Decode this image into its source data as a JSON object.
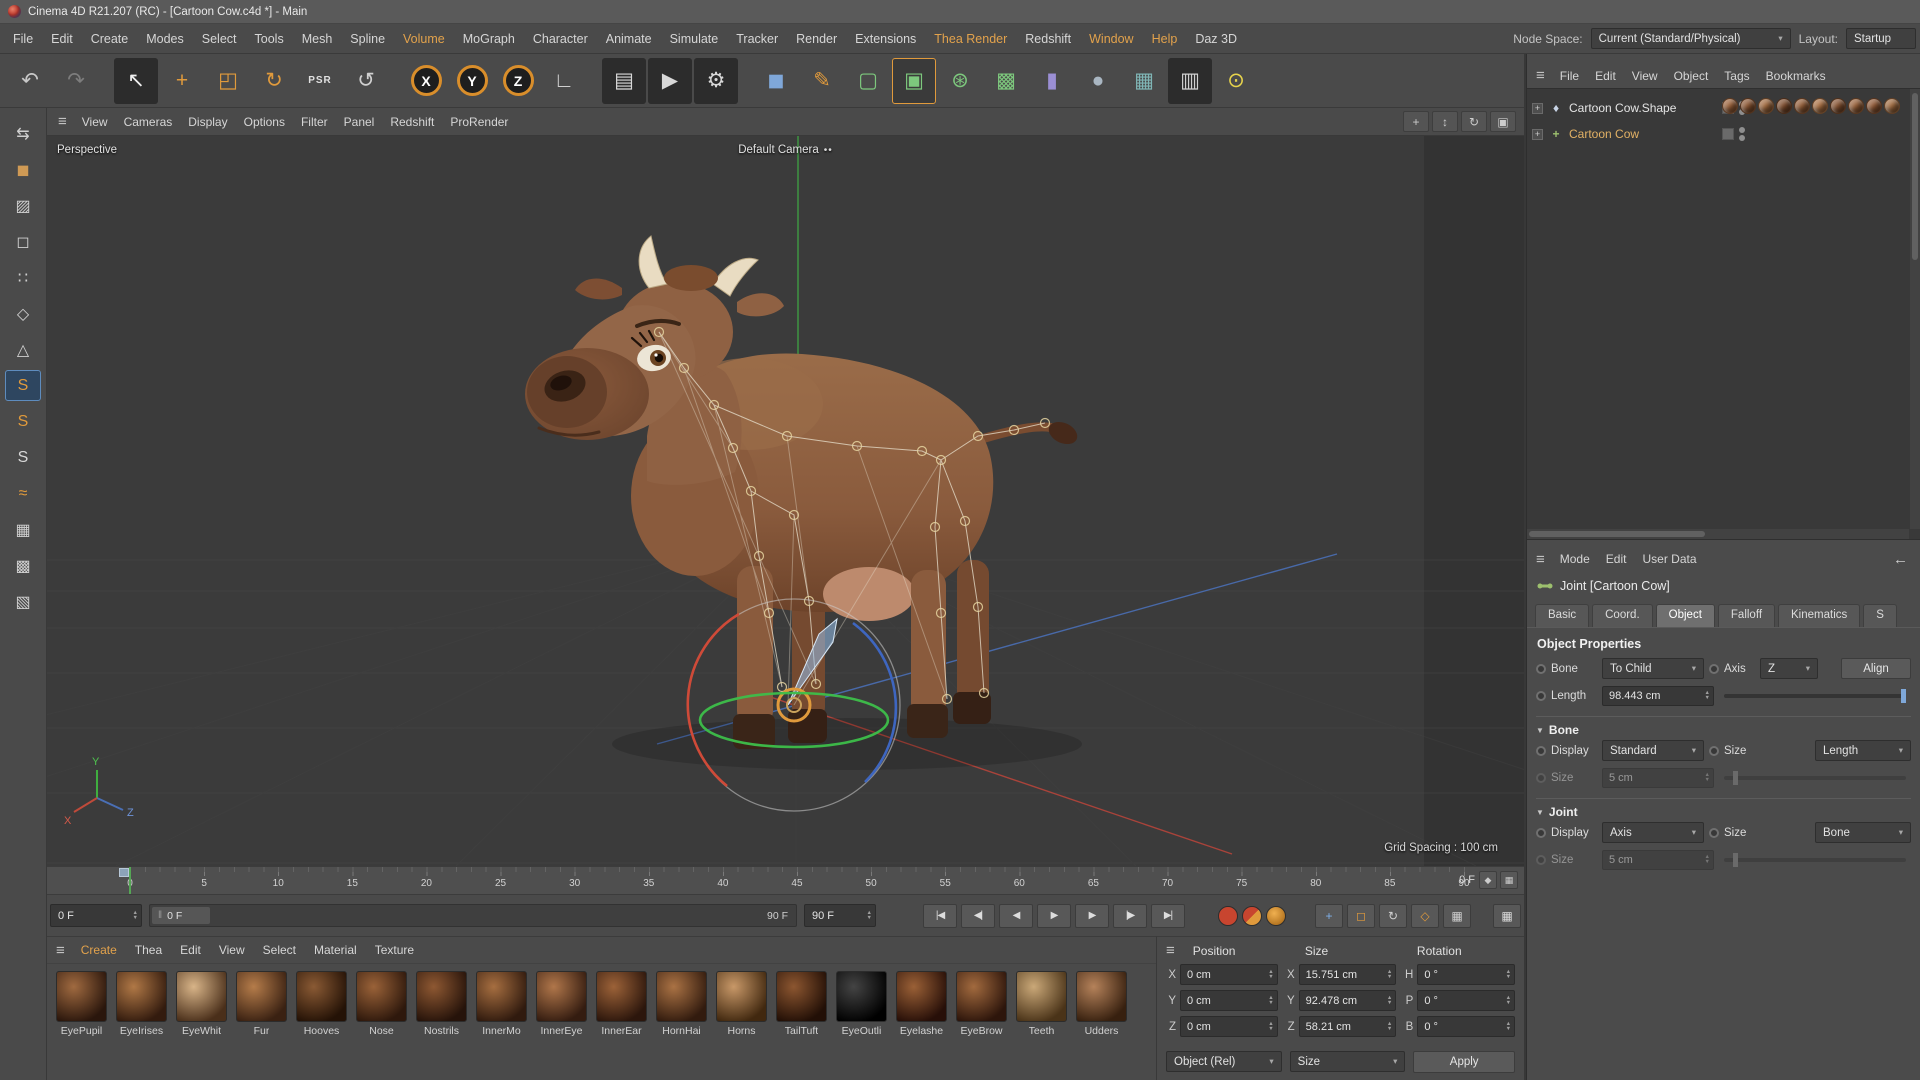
{
  "titlebar": {
    "title": "Cinema 4D R21.207 (RC) - [Cartoon Cow.c4d *] - Main"
  },
  "menubar": {
    "items": [
      {
        "label": "File"
      },
      {
        "label": "Edit"
      },
      {
        "label": "Create"
      },
      {
        "label": "Modes"
      },
      {
        "label": "Select"
      },
      {
        "label": "Tools"
      },
      {
        "label": "Mesh"
      },
      {
        "label": "Spline"
      },
      {
        "label": "Volume",
        "accent": true
      },
      {
        "label": "MoGraph"
      },
      {
        "label": "Character"
      },
      {
        "label": "Animate"
      },
      {
        "label": "Simulate"
      },
      {
        "label": "Tracker"
      },
      {
        "label": "Render"
      },
      {
        "label": "Extensions"
      },
      {
        "label": "Thea Render",
        "accent": true
      },
      {
        "label": "Redshift"
      },
      {
        "label": "Window",
        "accent": true
      },
      {
        "label": "Help",
        "accent": true
      },
      {
        "label": "Daz 3D"
      }
    ],
    "node_space_label": "Node Space:",
    "node_space_value": "Current (Standard/Physical)",
    "layout_label": "Layout:",
    "layout_value": "Startup"
  },
  "toolbar": {
    "buttons": [
      {
        "name": "undo-button",
        "glyph": "↶",
        "fg": "#c8c8c8"
      },
      {
        "name": "redo-button",
        "glyph": "↷",
        "fg": "#7d7d7d"
      },
      {
        "name": "toolbar-separator",
        "sep": true
      },
      {
        "name": "live-selection-tool",
        "glyph": "↖",
        "fg": "#f0f0f0",
        "bg": "#2c2c2c"
      },
      {
        "name": "move-tool",
        "glyph": "+",
        "fg": "#e09a3c"
      },
      {
        "name": "scale-tool",
        "glyph": "◰",
        "fg": "#e09a3c"
      },
      {
        "name": "rotate-tool",
        "glyph": "↻",
        "fg": "#e09a3c"
      },
      {
        "name": "psr-tool",
        "glyph": "PSR",
        "fg": "#e0e0e0",
        "small": true
      },
      {
        "name": "last-tool-used",
        "glyph": "↺",
        "fg": "#d0d0d0"
      },
      {
        "name": "toolbar-separator",
        "sep": true
      },
      {
        "name": "lock-x-axis",
        "glyph": "X",
        "ring": true
      },
      {
        "name": "lock-y-axis",
        "glyph": "Y",
        "ring": true
      },
      {
        "name": "lock-z-axis",
        "glyph": "Z",
        "ring": true
      },
      {
        "name": "coordinate-system",
        "glyph": "∟",
        "fg": "#d0d0d0"
      },
      {
        "name": "toolbar-separator",
        "sep": true
      },
      {
        "name": "render-view-button",
        "glyph": "▤",
        "fg": "#d8d8d8",
        "bg": "#2c2c2c"
      },
      {
        "name": "render-picture-viewer-button",
        "glyph": "▶",
        "fg": "#d8d8d8",
        "bg": "#2c2c2c"
      },
      {
        "name": "render-settings-button",
        "glyph": "⚙",
        "fg": "#d8d8d8",
        "bg": "#2c2c2c"
      },
      {
        "name": "toolbar-separator",
        "sep": true
      },
      {
        "name": "primitive-cube-menu",
        "glyph": "◼",
        "fg": "#7fa7d9"
      },
      {
        "name": "pen-spline-menu",
        "glyph": "✎",
        "fg": "#e09a3c"
      },
      {
        "name": "subdivision-surface-menu",
        "glyph": "▢",
        "fg": "#7dc87d"
      },
      {
        "name": "generators-menu",
        "glyph": "▣",
        "fg": "#7dc87d",
        "active": true
      },
      {
        "name": "modeling-menu",
        "glyph": "⊛",
        "fg": "#7dc87d"
      },
      {
        "name": "volume-menu",
        "glyph": "▩",
        "fg": "#7dc87d"
      },
      {
        "name": "spline-tools-menu",
        "glyph": "▮",
        "fg": "#9b8fd4"
      },
      {
        "name": "simulate-menu",
        "glyph": "●",
        "fg": "#a9b6c2"
      },
      {
        "name": "field-menu",
        "glyph": "▦",
        "fg": "#7fb5b5"
      },
      {
        "name": "camera-menu",
        "glyph": "▥",
        "fg": "#d0d0d0",
        "bg": "#2c2c2c"
      },
      {
        "name": "light-menu",
        "glyph": "⊙",
        "fg": "#e8d44c"
      }
    ]
  },
  "sidebar": {
    "buttons": [
      {
        "name": "make-editable-button",
        "glyph": "⇆",
        "fg": "#cfcfcf"
      },
      {
        "name": "model-mode-button",
        "glyph": "◼",
        "fg": "#cf9a55"
      },
      {
        "name": "texture-mode-button",
        "glyph": "▨",
        "fg": "#cfcfcf"
      },
      {
        "name": "workplane-mode-button",
        "glyph": "◻",
        "fg": "#cfcfcf"
      },
      {
        "name": "points-mode-button",
        "glyph": "∷",
        "fg": "#cfcfcf"
      },
      {
        "name": "edges-mode-button",
        "glyph": "◇",
        "fg": "#cfcfcf"
      },
      {
        "name": "polygons-mode-button",
        "glyph": "△",
        "fg": "#cfcfcf"
      },
      {
        "name": "enable-snap-button",
        "glyph": "S",
        "fg": "#e09a3c",
        "active": true
      },
      {
        "name": "snap-settings-button",
        "glyph": "S",
        "fg": "#e09a3c"
      },
      {
        "name": "snap-modes-button",
        "glyph": "S",
        "fg": "#d8d8d8"
      },
      {
        "name": "spline-snap-button",
        "glyph": "≈",
        "fg": "#e09a3c"
      },
      {
        "name": "quantize-button",
        "glyph": "▦",
        "fg": "#cfcfcf"
      },
      {
        "name": "workplane-lock-button",
        "glyph": "▩",
        "fg": "#cfcfcf"
      },
      {
        "name": "workplane-options-button",
        "glyph": "▧",
        "fg": "#cfcfcf"
      }
    ]
  },
  "viewport": {
    "menu": [
      {
        "label": "View"
      },
      {
        "label": "Cameras"
      },
      {
        "label": "Display"
      },
      {
        "label": "Options"
      },
      {
        "label": "Filter"
      },
      {
        "label": "Panel"
      },
      {
        "label": "Redshift"
      },
      {
        "label": "ProRender"
      }
    ],
    "nav": [
      {
        "name": "pan-view-button",
        "glyph": "+"
      },
      {
        "name": "zoom-view-button",
        "glyph": "↕"
      },
      {
        "name": "rotate-view-button",
        "glyph": "↻"
      },
      {
        "name": "maximize-view-button",
        "glyph": "▣"
      }
    ],
    "perspective_label": "Perspective",
    "camera_label": "Default Camera",
    "grid_spacing": "Grid Spacing : 100 cm",
    "axis_x": "X",
    "axis_y": "Y",
    "axis_z": "Z"
  },
  "timeline": {
    "ticks": [
      "0",
      "5",
      "10",
      "15",
      "20",
      "25",
      "30",
      "35",
      "40",
      "45",
      "50",
      "55",
      "60",
      "65",
      "70",
      "75",
      "80",
      "85",
      "90"
    ],
    "current_frame": "0 F",
    "ruler_buttons": [
      {
        "name": "ruler-marker-button",
        "glyph": "◆"
      },
      {
        "name": "ruler-options-button",
        "glyph": "▦"
      }
    ],
    "start_field": "0 F",
    "range_start": "0 F",
    "range_end": "90 F",
    "end_field": "90 F",
    "nav": [
      {
        "name": "goto-start-button",
        "glyph": "|◀"
      },
      {
        "name": "prev-key-button",
        "glyph": "◀|"
      },
      {
        "name": "prev-frame-button",
        "glyph": "◀"
      },
      {
        "name": "play-button",
        "glyph": "▶"
      },
      {
        "name": "next-frame-button",
        "glyph": "▶"
      },
      {
        "name": "next-key-button",
        "glyph": "|▶"
      },
      {
        "name": "goto-end-button",
        "glyph": "▶|"
      }
    ],
    "records": [
      {
        "name": "record-keyframe-button",
        "bg": "#c8452f"
      },
      {
        "name": "autokeying-button",
        "bg": "linear-gradient(135deg,#c8452f 50%,#e09a3c 50%)"
      },
      {
        "name": "keyframe-selection-button",
        "bg": "radial-gradient(circle at 40% 35%,#f0b050,#a06010)"
      }
    ],
    "toggles": [
      {
        "name": "key-position-toggle",
        "glyph": "+",
        "fg": "#7fb0e8"
      },
      {
        "name": "key-scale-toggle",
        "glyph": "◻",
        "fg": "#e09a3c"
      },
      {
        "name": "key-rotation-toggle",
        "glyph": "↻",
        "fg": "#d0d0d0"
      },
      {
        "name": "key-parameter-toggle",
        "glyph": "◇",
        "fg": "#e09a3c"
      },
      {
        "name": "key-pla-toggle",
        "glyph": "▦",
        "fg": "#d0d0d0"
      }
    ],
    "layout_button": {
      "glyph": "▦"
    }
  },
  "materials": {
    "menu": [
      {
        "label": "Create",
        "accent": true
      },
      {
        "label": "Thea"
      },
      {
        "label": "Edit"
      },
      {
        "label": "View"
      },
      {
        "label": "Select"
      },
      {
        "label": "Material"
      },
      {
        "label": "Texture"
      }
    ],
    "items": [
      {
        "name": "EyePupil",
        "c1": "#a06a40",
        "c2": "#2a160c"
      },
      {
        "name": "EyeIrises",
        "c1": "#b07846",
        "c2": "#331b0e"
      },
      {
        "name": "EyeWhit",
        "c1": "#d8b488",
        "c2": "#4a2f1a"
      },
      {
        "name": "Fur",
        "c1": "#b57c4a",
        "c2": "#3a2112"
      },
      {
        "name": "Hooves",
        "c1": "#8a5a34",
        "c2": "#241206"
      },
      {
        "name": "Nose",
        "c1": "#9a6238",
        "c2": "#2e180c"
      },
      {
        "name": "Nostrils",
        "c1": "#8e5832",
        "c2": "#26130a"
      },
      {
        "name": "InnerMo",
        "c1": "#a66e40",
        "c2": "#301a0e"
      },
      {
        "name": "InnerEye",
        "c1": "#b0764a",
        "c2": "#341c10"
      },
      {
        "name": "InnerEar",
        "c1": "#9c6238",
        "c2": "#2c160c"
      },
      {
        "name": "HornHai",
        "c1": "#aa7244",
        "c2": "#321b0e"
      },
      {
        "name": "Horns",
        "c1": "#c89868",
        "c2": "#41280f"
      },
      {
        "name": "TailTuft",
        "c1": "#8c5630",
        "c2": "#220f06"
      },
      {
        "name": "EyeOutli",
        "c1": "#444444",
        "c2": "#000000"
      },
      {
        "name": "Eyelashe",
        "c1": "#9a6036",
        "c2": "#270f08"
      },
      {
        "name": "EyeBrow",
        "c1": "#a26a3e",
        "c2": "#2d150b"
      },
      {
        "name": "Teeth",
        "c1": "#caa878",
        "c2": "#4a3318"
      },
      {
        "name": "Udders",
        "c1": "#b5825a",
        "c2": "#37200f"
      }
    ]
  },
  "coordinates": {
    "position_header": "Position",
    "size_header": "Size",
    "rotation_header": "Rotation",
    "rows": [
      {
        "p_label": "X",
        "p_value": "0 cm",
        "s_label": "X",
        "s_value": "15.751 cm",
        "r_label": "H",
        "r_value": "0 °"
      },
      {
        "p_label": "Y",
        "p_value": "0 cm",
        "s_label": "Y",
        "s_value": "92.478 cm",
        "r_label": "P",
        "r_value": "0 °"
      },
      {
        "p_label": "Z",
        "p_value": "0 cm",
        "s_label": "Z",
        "s_value": "58.21 cm",
        "r_label": "B",
        "r_value": "0 °"
      }
    ],
    "mode_value": "Object (Rel)",
    "size_mode_value": "Size",
    "apply_label": "Apply"
  },
  "object_manager": {
    "menu": [
      {
        "label": "File"
      },
      {
        "label": "Edit"
      },
      {
        "label": "View"
      },
      {
        "label": "Object"
      },
      {
        "label": "Tags"
      },
      {
        "label": "Bookmarks"
      }
    ],
    "objects": [
      {
        "name": "Cartoon Cow.Shape",
        "color": "#e4e4e4",
        "icon": "♦",
        "icon_color": "#c8d4e6"
      },
      {
        "name": "Cartoon Cow",
        "color": "#e2b165",
        "icon": "+",
        "icon_color": "#9dc06e"
      }
    ],
    "material_tags": [
      "#9a6038",
      "#8a5430",
      "#a0683c",
      "#7c4a2a",
      "#915a34",
      "#a86e40",
      "#84502e",
      "#965e36",
      "#8e5632",
      "#a06a3e"
    ]
  },
  "attributes": {
    "menu": [
      {
        "label": "Mode"
      },
      {
        "label": "Edit"
      },
      {
        "label": "User Data"
      }
    ],
    "back_arrow": "←",
    "title": "Joint [Cartoon Cow]",
    "tabs": [
      {
        "label": "Basic"
      },
      {
        "label": "Coord."
      },
      {
        "label": "Object",
        "active": true
      },
      {
        "label": "Falloff"
      },
      {
        "label": "Kinematics"
      },
      {
        "label": "S"
      }
    ],
    "section_title": "Object Properties",
    "bone_label": "Bone",
    "bone_value": "To Child",
    "axis_label": "Axis",
    "axis_value": "Z",
    "align_label": "Align",
    "length_label": "Length",
    "length_value": "98.443 cm",
    "bone_group_title": "Bone",
    "bone_display_label": "Display",
    "bone_display_value": "Standard",
    "bone_size_label": "Size",
    "bone_size_value": "Length",
    "bone_size2_label": "Size",
    "bone_size2_value": "5 cm",
    "joint_group_title": "Joint",
    "joint_display_label": "Display",
    "joint_display_value": "Axis",
    "joint_size_label": "Size",
    "joint_size_value": "Bone",
    "joint_size2_label": "Size",
    "joint_size2_value": "5 cm"
  }
}
